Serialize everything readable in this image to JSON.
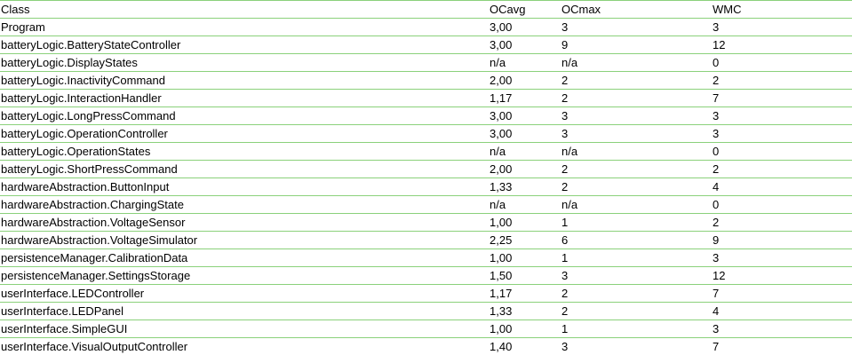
{
  "table": {
    "headers": [
      "Class",
      "OCavg",
      "OCmax",
      "WMC"
    ],
    "rows": [
      [
        "Program",
        "3,00",
        "3",
        "3"
      ],
      [
        "batteryLogic.BatteryStateController",
        "3,00",
        "9",
        "12"
      ],
      [
        "batteryLogic.DisplayStates",
        "n/a",
        "n/a",
        "0"
      ],
      [
        "batteryLogic.InactivityCommand",
        "2,00",
        "2",
        "2"
      ],
      [
        "batteryLogic.InteractionHandler",
        "1,17",
        "2",
        "7"
      ],
      [
        "batteryLogic.LongPressCommand",
        "3,00",
        "3",
        "3"
      ],
      [
        "batteryLogic.OperationController",
        "3,00",
        "3",
        "3"
      ],
      [
        "batteryLogic.OperationStates",
        "n/a",
        "n/a",
        "0"
      ],
      [
        "batteryLogic.ShortPressCommand",
        "2,00",
        "2",
        "2"
      ],
      [
        "hardwareAbstraction.ButtonInput",
        "1,33",
        "2",
        "4"
      ],
      [
        "hardwareAbstraction.ChargingState",
        "n/a",
        "n/a",
        "0"
      ],
      [
        "hardwareAbstraction.VoltageSensor",
        "1,00",
        "1",
        "2"
      ],
      [
        "hardwareAbstraction.VoltageSimulator",
        "2,25",
        "6",
        "9"
      ],
      [
        "persistenceManager.CalibrationData",
        "1,00",
        "1",
        "3"
      ],
      [
        "persistenceManager.SettingsStorage",
        "1,50",
        "3",
        "12"
      ],
      [
        "userInterface.LEDController",
        "1,17",
        "2",
        "7"
      ],
      [
        "userInterface.LEDPanel",
        "1,33",
        "2",
        "4"
      ],
      [
        "userInterface.SimpleGUI",
        "1,00",
        "1",
        "3"
      ],
      [
        "userInterface.VisualOutputController",
        "1,40",
        "3",
        "7"
      ]
    ]
  },
  "colors": {
    "grid_line": "#8bd17b",
    "text": "#000000",
    "background": "#ffffff"
  }
}
